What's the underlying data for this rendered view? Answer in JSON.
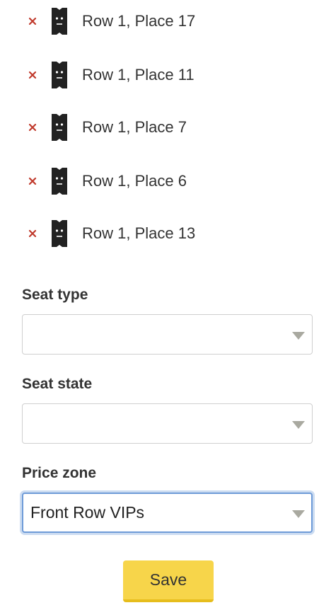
{
  "seats": [
    {
      "label": "Row 1, Place 17"
    },
    {
      "label": "Row 1, Place 11"
    },
    {
      "label": "Row 1, Place 7"
    },
    {
      "label": "Row 1, Place 6"
    },
    {
      "label": "Row 1, Place 13"
    }
  ],
  "form": {
    "seat_type": {
      "label": "Seat type",
      "value": ""
    },
    "seat_state": {
      "label": "Seat state",
      "value": ""
    },
    "price_zone": {
      "label": "Price zone",
      "value": "Front Row VIPs"
    },
    "save_label": "Save"
  },
  "colors": {
    "remove": "#c0392b",
    "icon": "#222222",
    "save_button": "#f7d54a",
    "focus_border": "#6e9bd8"
  },
  "icons": {
    "remove": "close-icon",
    "seat": "ticket-icon"
  }
}
